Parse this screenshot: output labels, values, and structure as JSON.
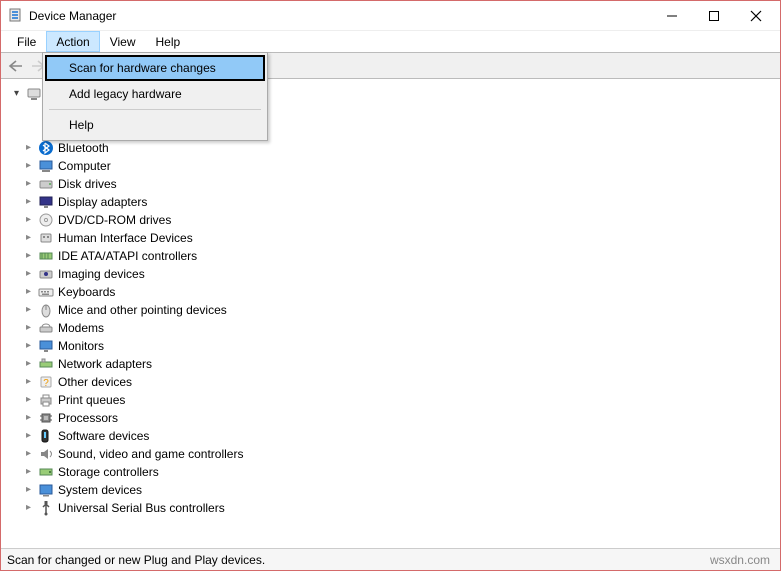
{
  "window": {
    "title": "Device Manager"
  },
  "menubar": {
    "file": "File",
    "action": "Action",
    "view": "View",
    "help": "Help"
  },
  "action_menu": {
    "scan": "Scan for hardware changes",
    "add_legacy": "Add legacy hardware",
    "help": "Help"
  },
  "tree": {
    "root_obscured": "",
    "items": [
      {
        "label": "Bluetooth",
        "icon": "bluetooth"
      },
      {
        "label": "Computer",
        "icon": "computer"
      },
      {
        "label": "Disk drives",
        "icon": "disk"
      },
      {
        "label": "Display adapters",
        "icon": "display"
      },
      {
        "label": "DVD/CD-ROM drives",
        "icon": "dvd"
      },
      {
        "label": "Human Interface Devices",
        "icon": "hid"
      },
      {
        "label": "IDE ATA/ATAPI controllers",
        "icon": "ide"
      },
      {
        "label": "Imaging devices",
        "icon": "imaging"
      },
      {
        "label": "Keyboards",
        "icon": "keyboard"
      },
      {
        "label": "Mice and other pointing devices",
        "icon": "mouse"
      },
      {
        "label": "Modems",
        "icon": "modem"
      },
      {
        "label": "Monitors",
        "icon": "monitor"
      },
      {
        "label": "Network adapters",
        "icon": "network"
      },
      {
        "label": "Other devices",
        "icon": "other"
      },
      {
        "label": "Print queues",
        "icon": "printer"
      },
      {
        "label": "Processors",
        "icon": "cpu"
      },
      {
        "label": "Software devices",
        "icon": "software"
      },
      {
        "label": "Sound, video and game controllers",
        "icon": "sound"
      },
      {
        "label": "Storage controllers",
        "icon": "storage"
      },
      {
        "label": "System devices",
        "icon": "system"
      },
      {
        "label": "Universal Serial Bus controllers",
        "icon": "usb"
      }
    ]
  },
  "status": {
    "left": "Scan for changed or new Plug and Play devices.",
    "right": "wsxdn.com"
  }
}
